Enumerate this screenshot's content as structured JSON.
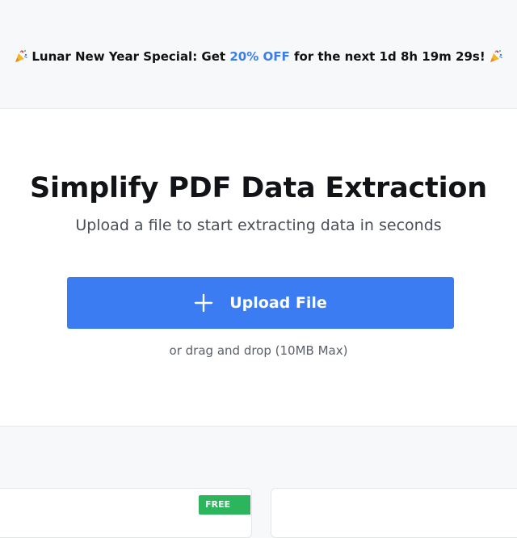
{
  "promo": {
    "prefix": "Lunar New Year Special: Get",
    "discount": "20% OFF",
    "suffix": "for the next 1d 8h 19m 29s!",
    "icon": "party-popper-icon",
    "highlight_color": "#3d7ee6"
  },
  "hero": {
    "title": "Simplify PDF Data Extraction",
    "subtitle": "Upload a file to start extracting data in seconds",
    "upload_button_label": "Upload File",
    "upload_icon": "plus-icon",
    "drag_hint": "or drag and drop (10MB Max)",
    "button_color": "#3b7cf2"
  },
  "cards": {
    "badge_label": "FREE",
    "badge_color": "#2db55d"
  }
}
